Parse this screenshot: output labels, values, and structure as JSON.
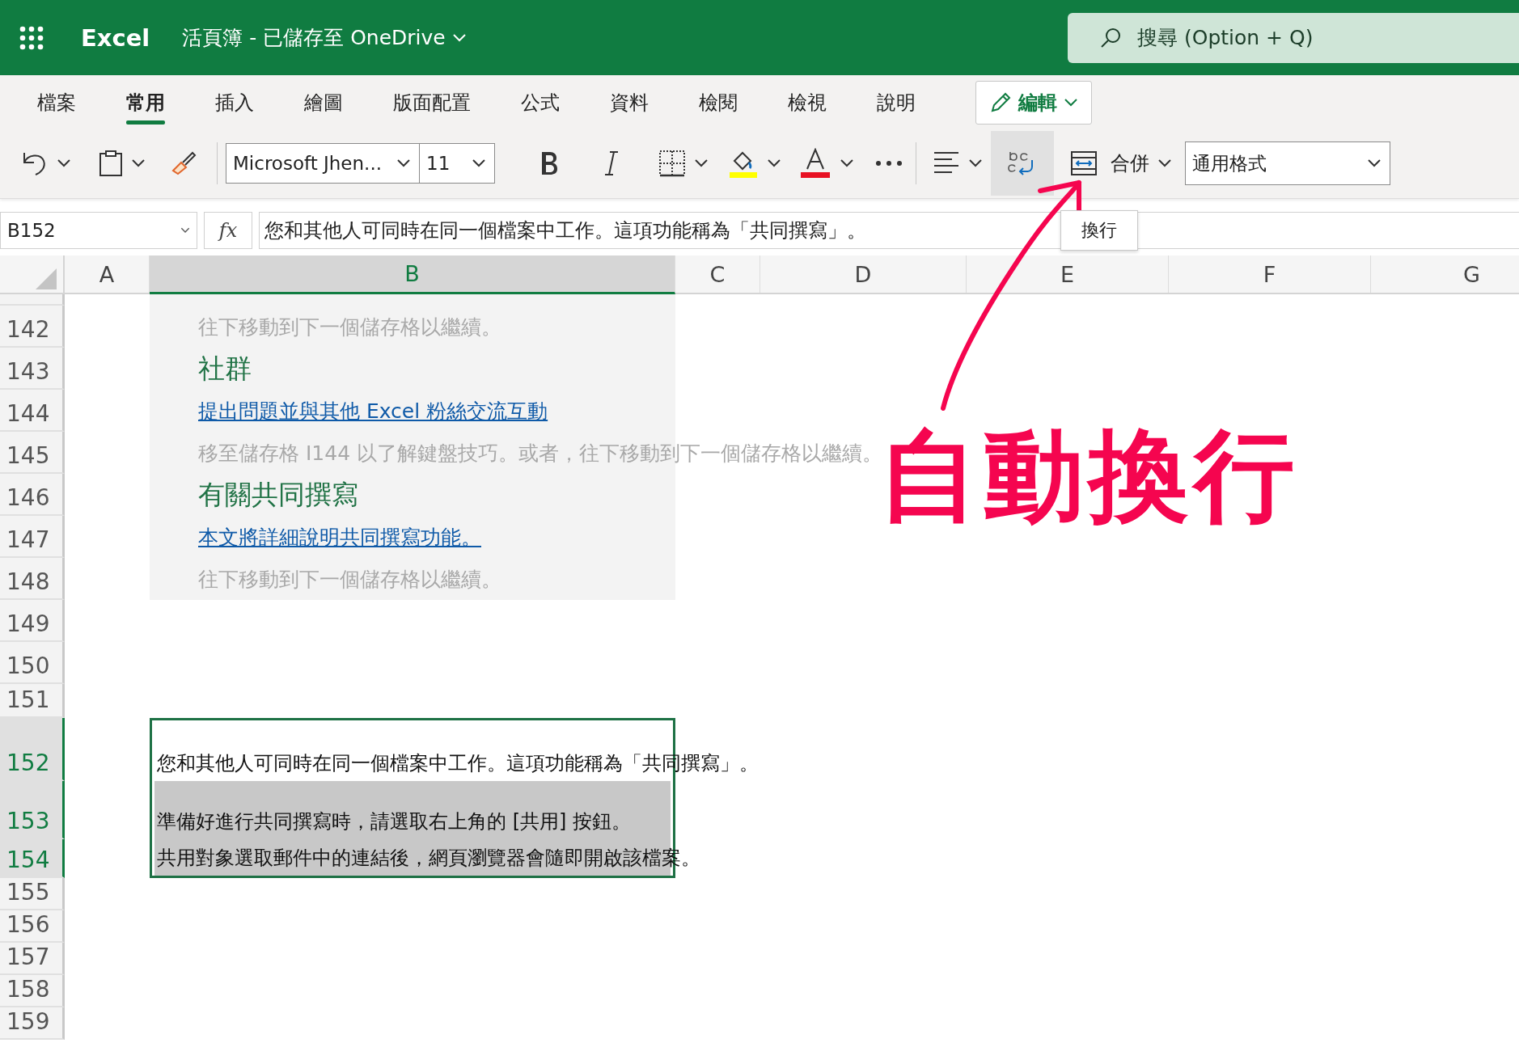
{
  "app": {
    "name": "Excel",
    "document_title": "活頁簿 - 已儲存至 OneDrive"
  },
  "search": {
    "placeholder": "搜尋 (Option + Q)"
  },
  "ribbon_tabs": [
    {
      "label": "檔案",
      "selected": false
    },
    {
      "label": "常用",
      "selected": true
    },
    {
      "label": "插入",
      "selected": false
    },
    {
      "label": "繪圖",
      "selected": false
    },
    {
      "label": "版面配置",
      "selected": false
    },
    {
      "label": "公式",
      "selected": false
    },
    {
      "label": "資料",
      "selected": false
    },
    {
      "label": "檢閱",
      "selected": false
    },
    {
      "label": "檢視",
      "selected": false
    },
    {
      "label": "說明",
      "selected": false
    }
  ],
  "edit_mode_button": "編輯",
  "toolbar": {
    "font_name": "Microsoft Jhen...",
    "font_size": "11",
    "merge_label": "合併",
    "number_format": "通用格式",
    "wrap_text_hovered": true
  },
  "tooltip": "換行",
  "name_box": "B152",
  "formula_label": "fx",
  "formula": "您和其他人可同時在同一個檔案中工作。這項功能稱為「共同撰寫」。",
  "columns": [
    {
      "label": "A",
      "selected": false
    },
    {
      "label": "B",
      "selected": true
    },
    {
      "label": "C",
      "selected": false
    },
    {
      "label": "D",
      "selected": false
    },
    {
      "label": "E",
      "selected": false
    },
    {
      "label": "F",
      "selected": false
    },
    {
      "label": "G",
      "selected": false
    }
  ],
  "rows": [
    {
      "number": "142",
      "selected": false,
      "panel": true,
      "highlighted": false,
      "cell": {
        "kind": "note",
        "text": "往下移動到下一個儲存格以繼續。"
      }
    },
    {
      "number": "143",
      "selected": false,
      "panel": true,
      "highlighted": false,
      "cell": {
        "kind": "heading",
        "text": "社群"
      }
    },
    {
      "number": "144",
      "selected": false,
      "panel": true,
      "highlighted": false,
      "cell": {
        "kind": "link",
        "text": "提出問題並與其他 Excel 粉絲交流互動"
      }
    },
    {
      "number": "145",
      "selected": false,
      "panel": true,
      "highlighted": false,
      "cell": {
        "kind": "note",
        "text": "移至儲存格 I144 以了解鍵盤技巧。或者，往下移動到下一個儲存格以繼續。"
      }
    },
    {
      "number": "146",
      "selected": false,
      "panel": true,
      "highlighted": false,
      "cell": {
        "kind": "heading",
        "text": "有關共同撰寫"
      }
    },
    {
      "number": "147",
      "selected": false,
      "panel": true,
      "highlighted": false,
      "cell": {
        "kind": "link",
        "text": "本文將詳細說明共同撰寫功能。"
      }
    },
    {
      "number": "148",
      "selected": false,
      "panel": true,
      "highlighted": false,
      "cell": {
        "kind": "note",
        "text": "往下移動到下一個儲存格以繼續。"
      }
    },
    {
      "number": "149",
      "selected": false,
      "panel": false,
      "highlighted": false
    },
    {
      "number": "150",
      "selected": false,
      "panel": false,
      "highlighted": false
    },
    {
      "number": "151",
      "selected": false,
      "panel": false,
      "highlighted": false
    },
    {
      "number": "152",
      "selected": true,
      "panel": false,
      "highlighted": false,
      "cell": {
        "kind": "text",
        "text": "您和其他人可同時在同一個檔案中工作。這項功能稱為「共同撰寫」。"
      }
    },
    {
      "number": "153",
      "selected": true,
      "panel": false,
      "highlighted": true,
      "cell": {
        "kind": "text",
        "text": "準備好進行共同撰寫時，請選取右上角的 [共用] 按鈕。"
      }
    },
    {
      "number": "154",
      "selected": true,
      "panel": false,
      "highlighted": true,
      "cell": {
        "kind": "text",
        "text": "共用對象選取郵件中的連結後，網頁瀏覽器會隨即開啟該檔案。"
      }
    },
    {
      "number": "155",
      "selected": false,
      "panel": false,
      "highlighted": false
    },
    {
      "number": "156",
      "selected": false,
      "panel": false,
      "highlighted": false
    },
    {
      "number": "157",
      "selected": false,
      "panel": false,
      "highlighted": false
    },
    {
      "number": "158",
      "selected": false,
      "panel": false,
      "highlighted": false
    },
    {
      "number": "159",
      "selected": false,
      "panel": false,
      "highlighted": false
    }
  ],
  "annotation": "自動換行"
}
